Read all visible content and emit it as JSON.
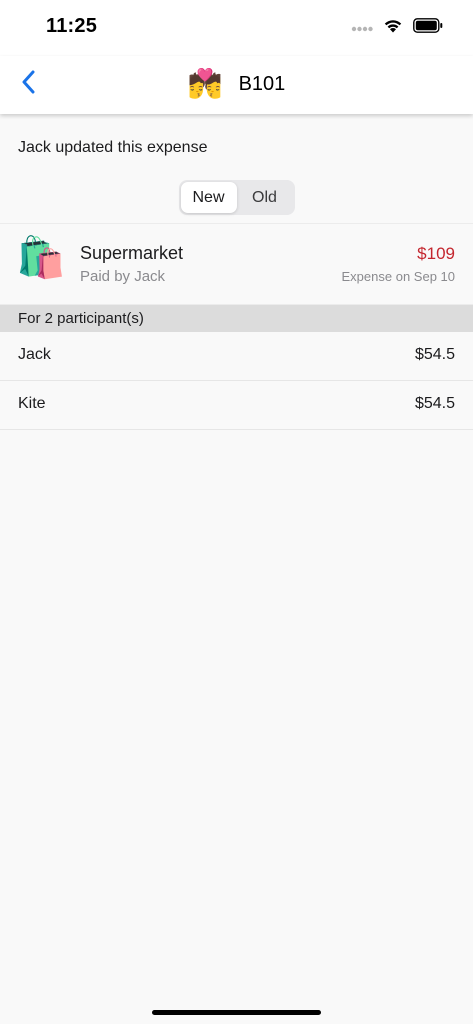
{
  "status_bar": {
    "time": "11:25",
    "icons": [
      "cellular-signal-icon",
      "wifi-icon",
      "battery-icon"
    ]
  },
  "nav": {
    "back_icon": "chevron-left-icon",
    "emoji": "💏",
    "title": "B101",
    "accent_color": "#1a73e8"
  },
  "update_note": "Jack updated this expense",
  "segment": {
    "options": [
      "New",
      "Old"
    ],
    "selected": "New"
  },
  "expense": {
    "icon": "🛍️",
    "name": "Supermarket",
    "payer": "Paid by Jack",
    "amount": "$109",
    "amount_color": "#c4262e",
    "date": "Expense on Sep 10"
  },
  "participants_header": "For 2 participant(s)",
  "participants": [
    {
      "name": "Jack",
      "amount": "$54.5"
    },
    {
      "name": "Kite",
      "amount": "$54.5"
    }
  ]
}
